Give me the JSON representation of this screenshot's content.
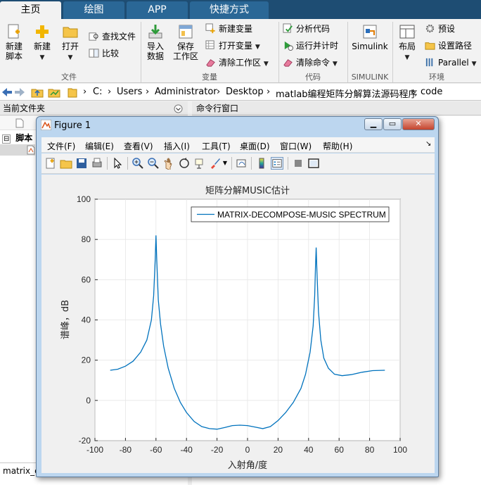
{
  "tabs": [
    "主页",
    "绘图",
    "APP",
    "快捷方式"
  ],
  "ribbon": {
    "new_script": [
      "新建",
      "脚本"
    ],
    "new": "新建",
    "open": "打开",
    "find_files": "查找文件",
    "compare": "比较",
    "import": [
      "导入",
      "数据"
    ],
    "save_ws": [
      "保存",
      "工作区"
    ],
    "new_var": "新建变量",
    "open_var": "打开变量",
    "clear_ws": "清除工作区",
    "analyze": "分析代码",
    "run_time": "运行并计时",
    "clear_cmd": "清除命令",
    "simulink": "Simulink",
    "layout": "布局",
    "prefs": "预设",
    "set_path": "设置路径",
    "parallel": "Parallel",
    "groups": [
      "文件",
      "变量",
      "代码",
      "SIMULINK",
      "环境"
    ]
  },
  "address": {
    "parts": [
      "C:",
      "Users",
      "Administrator",
      "Desktop",
      "matlab编程矩阵分解算法源码程序",
      "code"
    ]
  },
  "panels": {
    "current_folder": "当前文件夹",
    "command_window": "命令行窗口",
    "tree_label": "脚本",
    "file_item": "matrix_c"
  },
  "figure": {
    "title": "Figure 1",
    "menu": [
      "文件(F)",
      "编辑(E)",
      "查看(V)",
      "插入(I)",
      "工具(T)",
      "桌面(D)",
      "窗口(W)",
      "帮助(H)"
    ]
  },
  "chart_data": {
    "type": "line",
    "title": "矩阵分解MUSIC估计",
    "xlabel": "入射角/度",
    "ylabel": "谱峰，dB",
    "xlim": [
      -100,
      100
    ],
    "ylim": [
      -20,
      100
    ],
    "xticks": [
      -100,
      -80,
      -60,
      -40,
      -20,
      0,
      20,
      40,
      60,
      80,
      100
    ],
    "yticks": [
      -20,
      0,
      20,
      40,
      60,
      80,
      100
    ],
    "grid": true,
    "legend_position": "top-right",
    "series": [
      {
        "name": "MATRIX-DECOMPOSE-MUSIC SPECTRUM",
        "color": "#0072bd",
        "x": [
          -90,
          -85,
          -80,
          -75,
          -70,
          -66,
          -63,
          -61.5,
          -60.5,
          -60,
          -59.5,
          -58.5,
          -57,
          -55,
          -52,
          -48,
          -44,
          -40,
          -35,
          -30,
          -25,
          -20,
          -15,
          -10,
          -5,
          0,
          5,
          10,
          15,
          20,
          25,
          30,
          35,
          38,
          41,
          43,
          44,
          44.5,
          45,
          45.5,
          46.5,
          48,
          50,
          53,
          57,
          62,
          68,
          75,
          82,
          90
        ],
        "y": [
          15,
          15.5,
          17,
          19.5,
          24,
          30,
          40,
          52,
          70,
          82,
          70,
          50,
          38,
          27,
          16,
          6,
          -1,
          -6,
          -10.5,
          -13,
          -14,
          -14.3,
          -13.5,
          -12.5,
          -12.3,
          -12.5,
          -13.3,
          -14,
          -13,
          -10,
          -6,
          -1,
          6,
          13,
          24,
          37,
          52,
          66,
          76,
          64,
          44,
          30,
          21,
          16,
          13,
          12.3,
          12.8,
          14,
          14.8,
          15
        ]
      }
    ]
  }
}
